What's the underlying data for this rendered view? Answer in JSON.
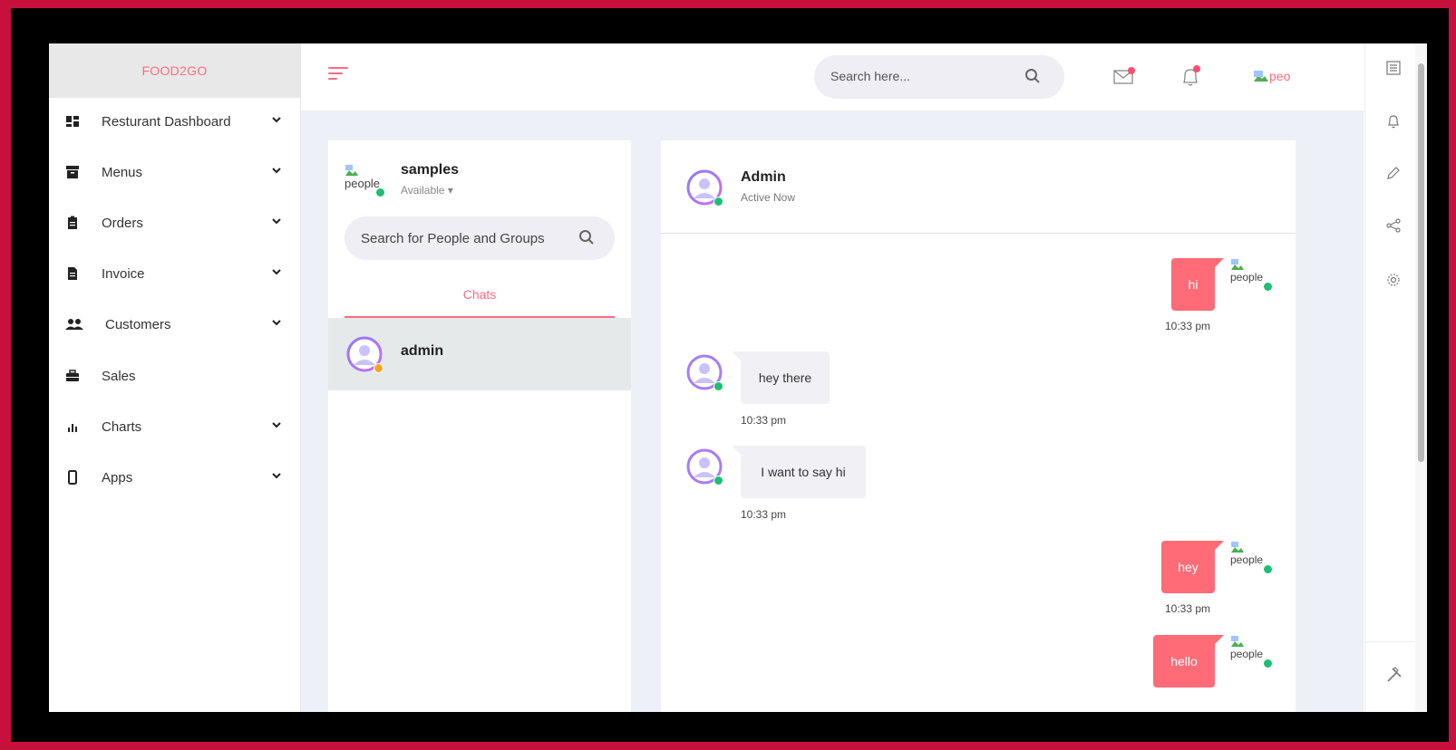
{
  "brand": "FOOD2GO",
  "sidebar": {
    "items": [
      {
        "label": "Resturant Dashboard",
        "icon": "dashboard-icon",
        "has_chevron": true
      },
      {
        "label": "Menus",
        "icon": "archive-icon",
        "has_chevron": true
      },
      {
        "label": "Orders",
        "icon": "clipboard-icon",
        "has_chevron": true
      },
      {
        "label": "Invoice",
        "icon": "file-invoice-icon",
        "has_chevron": true
      },
      {
        "label": "Customers",
        "icon": "users-icon",
        "has_chevron": true
      },
      {
        "label": "Sales",
        "icon": "briefcase-icon",
        "has_chevron": false
      },
      {
        "label": "Charts",
        "icon": "bar-chart-icon",
        "has_chevron": true
      },
      {
        "label": "Apps",
        "icon": "mobile-icon",
        "has_chevron": true
      }
    ]
  },
  "topbar": {
    "search_placeholder": "Search here...",
    "profile_alt": "peo",
    "mail_has_notification": true,
    "bell_has_notification": true
  },
  "chat_list": {
    "me": {
      "name": "samples",
      "status": "Available",
      "img_alt": "people"
    },
    "search_placeholder": "Search for People and Groups",
    "tab": "Chats",
    "contacts": [
      {
        "name": "admin",
        "status_color": "#f5a623"
      }
    ]
  },
  "conversation": {
    "name": "Admin",
    "status": "Active Now",
    "peer_img_alt": "people",
    "messages": [
      {
        "dir": "out",
        "text": "hi",
        "time": "10:33 pm"
      },
      {
        "dir": "in",
        "text": "hey there",
        "time": "10:33 pm"
      },
      {
        "dir": "in",
        "text": "I want to say hi",
        "time": "10:33 pm"
      },
      {
        "dir": "out",
        "text": "hey",
        "time": "10:33 pm"
      },
      {
        "dir": "out",
        "text": "hello",
        "time": ""
      }
    ]
  },
  "colors": {
    "accent": "#ff6b81",
    "online": "#1dbf73",
    "away": "#f5a623",
    "frame": "#c8103c"
  }
}
